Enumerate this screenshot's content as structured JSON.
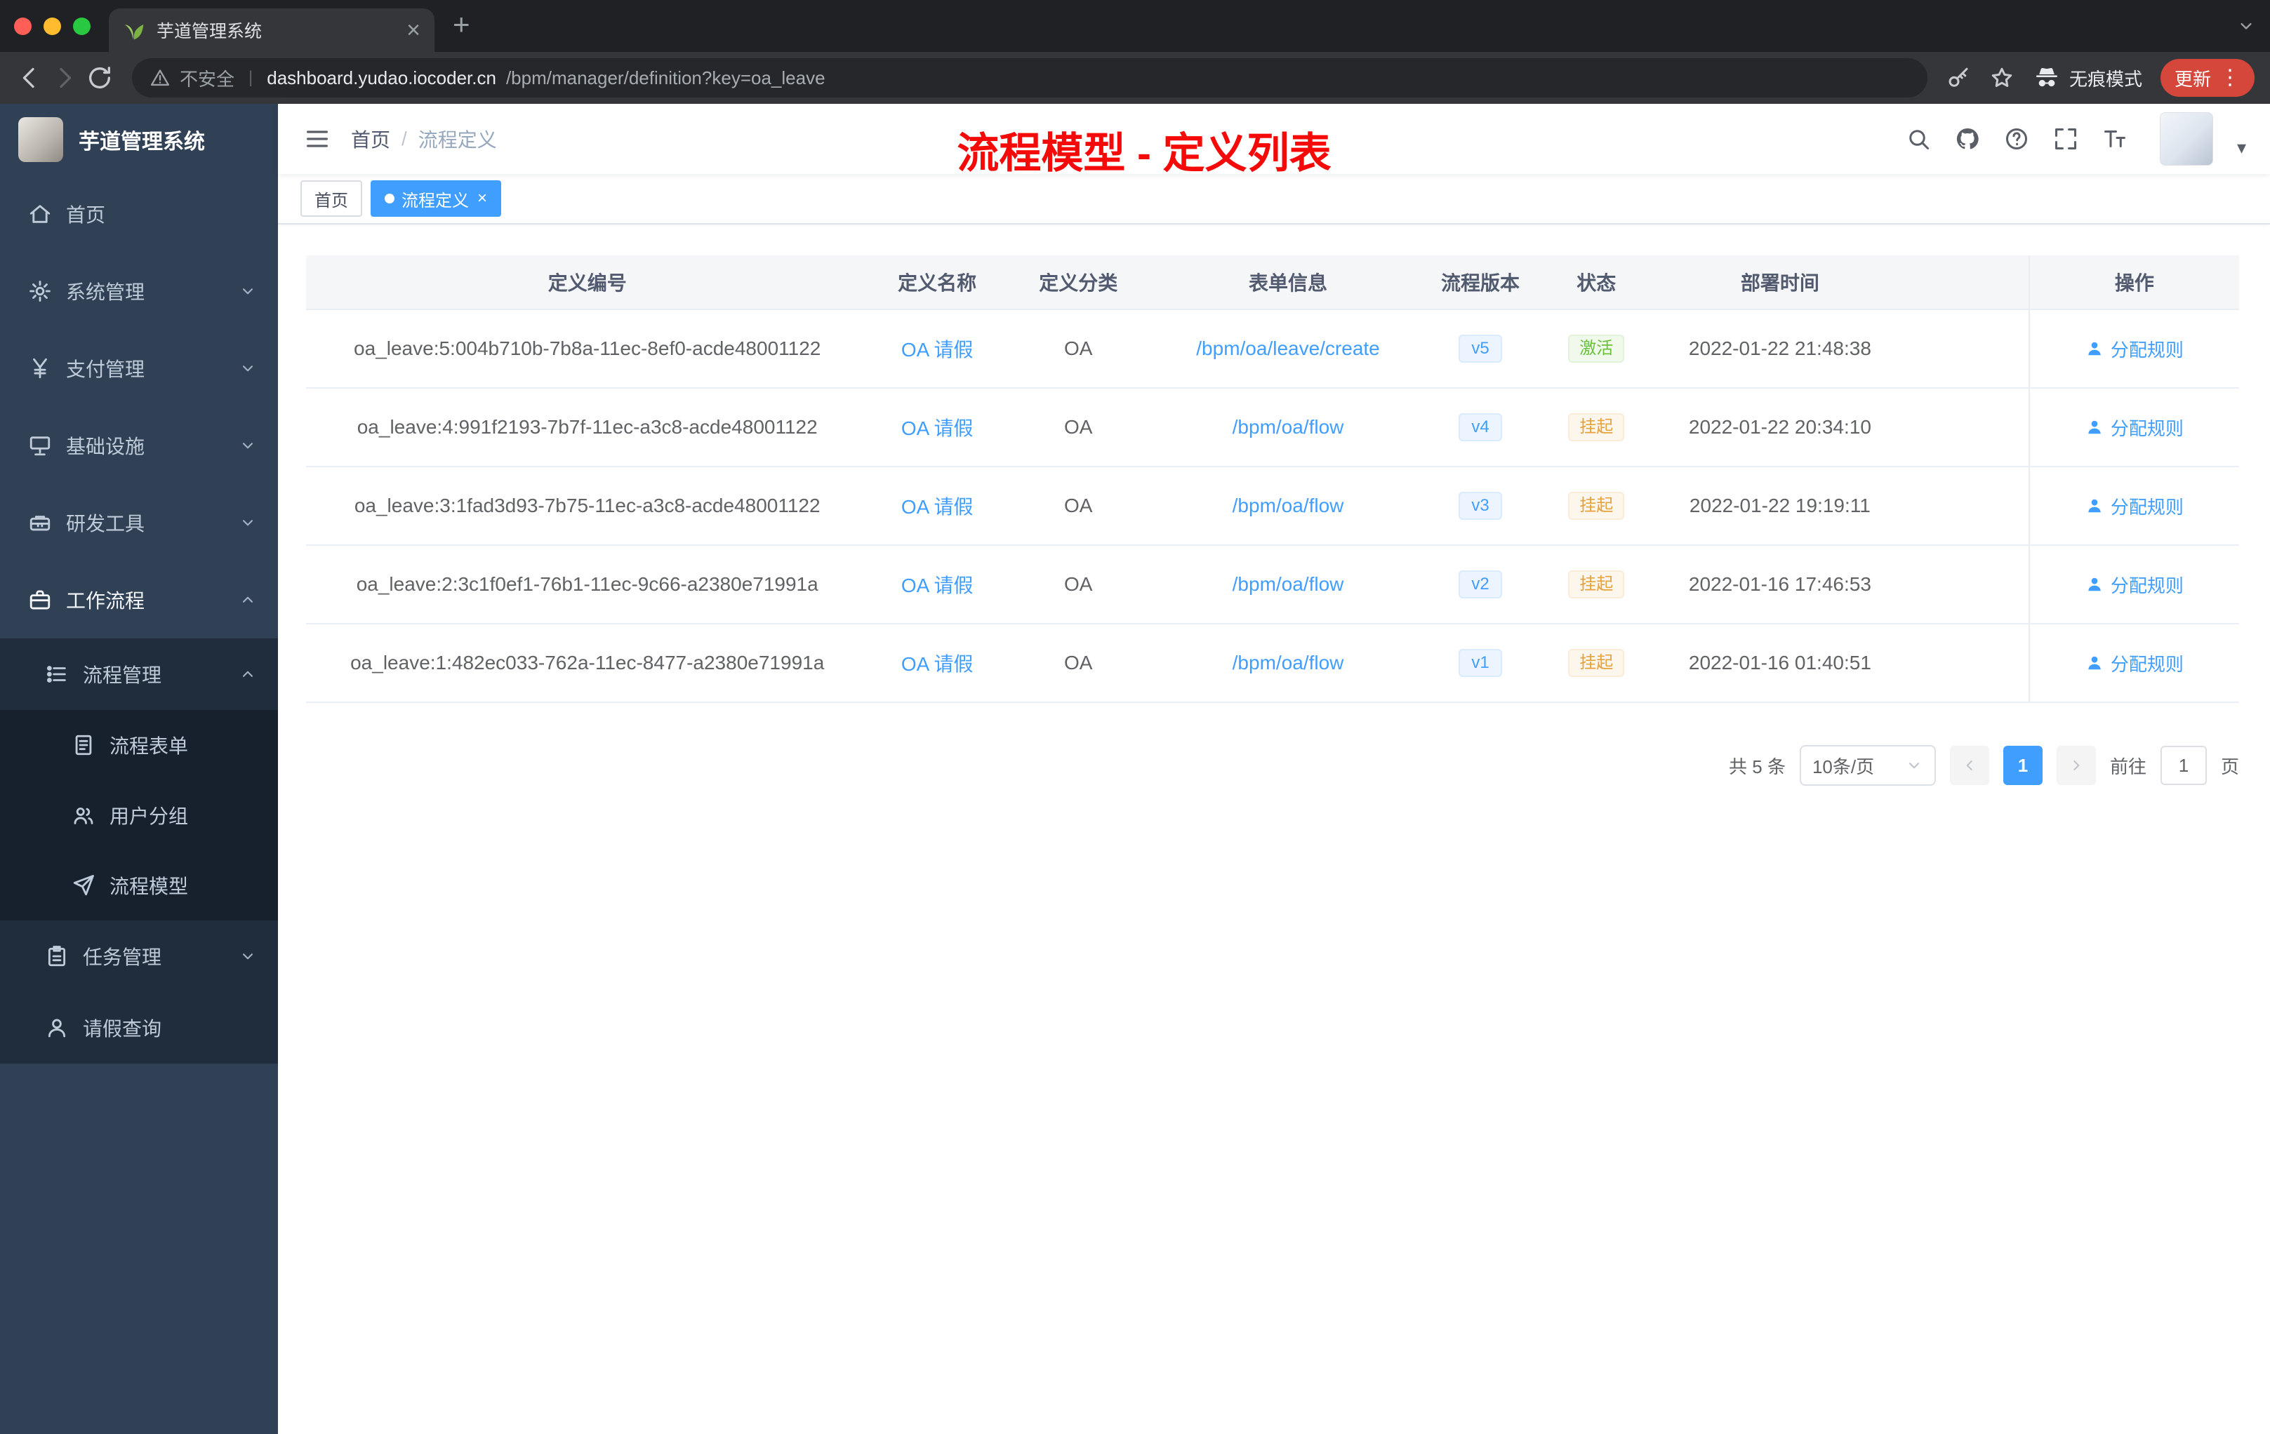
{
  "browser": {
    "tab_title": "芋道管理系统",
    "security_label": "不安全",
    "url_host": "dashboard.yudao.iocoder.cn",
    "url_path": "/bpm/manager/definition?key=oa_leave",
    "incognito_label": "无痕模式",
    "update_label": "更新"
  },
  "sidebar": {
    "logo_title": "芋道管理系统",
    "items": [
      {
        "key": "home",
        "label": "首页",
        "icon": "home",
        "level": 0
      },
      {
        "key": "system",
        "label": "系统管理",
        "icon": "gear",
        "level": 0,
        "chevron": "down"
      },
      {
        "key": "payment",
        "label": "支付管理",
        "icon": "yen",
        "level": 0,
        "chevron": "down"
      },
      {
        "key": "infrastructure",
        "label": "基础设施",
        "icon": "server",
        "level": 0,
        "chevron": "down"
      },
      {
        "key": "devtools",
        "label": "研发工具",
        "icon": "toolbox",
        "level": 0,
        "chevron": "down"
      },
      {
        "key": "workflow",
        "label": "工作流程",
        "icon": "briefcase",
        "level": 0,
        "chevron": "up",
        "active": true
      },
      {
        "key": "process-management",
        "label": "流程管理",
        "icon": "tree",
        "level": 1,
        "chevron": "up"
      },
      {
        "key": "process-form",
        "label": "流程表单",
        "icon": "doc",
        "level": 2
      },
      {
        "key": "user-group",
        "label": "用户分组",
        "icon": "users",
        "level": 2
      },
      {
        "key": "process-model",
        "label": "流程模型",
        "icon": "send",
        "level": 2
      },
      {
        "key": "task-management",
        "label": "任务管理",
        "icon": "tasks",
        "level": 1,
        "chevron": "down"
      },
      {
        "key": "leave-query",
        "label": "请假查询",
        "icon": "user",
        "level": 1
      }
    ]
  },
  "header": {
    "breadcrumb_home": "首页",
    "breadcrumb_current": "流程定义",
    "annotation": "流程模型 - 定义列表"
  },
  "tags": [
    {
      "key": "home",
      "label": "首页",
      "active": false
    },
    {
      "key": "process-definition",
      "label": "流程定义",
      "active": true
    }
  ],
  "table": {
    "columns": [
      "定义编号",
      "定义名称",
      "定义分类",
      "表单信息",
      "流程版本",
      "状态",
      "部署时间",
      "操作"
    ],
    "rows": [
      {
        "id": "oa_leave:5:004b710b-7b8a-11ec-8ef0-acde48001122",
        "name": "OA 请假",
        "category": "OA",
        "form": "/bpm/oa/leave/create",
        "version": "v5",
        "status": "激活",
        "status_type": "success",
        "time": "2022-01-22 21:48:38",
        "action": "分配规则"
      },
      {
        "id": "oa_leave:4:991f2193-7b7f-11ec-a3c8-acde48001122",
        "name": "OA 请假",
        "category": "OA",
        "form": "/bpm/oa/flow",
        "version": "v4",
        "status": "挂起",
        "status_type": "warning",
        "time": "2022-01-22 20:34:10",
        "action": "分配规则"
      },
      {
        "id": "oa_leave:3:1fad3d93-7b75-11ec-a3c8-acde48001122",
        "name": "OA 请假",
        "category": "OA",
        "form": "/bpm/oa/flow",
        "version": "v3",
        "status": "挂起",
        "status_type": "warning",
        "time": "2022-01-22 19:19:11",
        "action": "分配规则"
      },
      {
        "id": "oa_leave:2:3c1f0ef1-76b1-11ec-9c66-a2380e71991a",
        "name": "OA 请假",
        "category": "OA",
        "form": "/bpm/oa/flow",
        "version": "v2",
        "status": "挂起",
        "status_type": "warning",
        "time": "2022-01-16 17:46:53",
        "action": "分配规则"
      },
      {
        "id": "oa_leave:1:482ec033-762a-11ec-8477-a2380e71991a",
        "name": "OA 请假",
        "category": "OA",
        "form": "/bpm/oa/flow",
        "version": "v1",
        "status": "挂起",
        "status_type": "warning",
        "time": "2022-01-16 01:40:51",
        "action": "分配规则"
      }
    ]
  },
  "pagination": {
    "total_label": "共 5 条",
    "page_size_label": "10条/页",
    "current_page": "1",
    "goto_label": "前往",
    "goto_value": "1",
    "page_unit": "页"
  },
  "colors": {
    "accent": "#409eff",
    "success": "#67c23a",
    "warning": "#e6a23c",
    "sidebar_bg": "#304156",
    "annotation_red": "#f50a0a"
  }
}
